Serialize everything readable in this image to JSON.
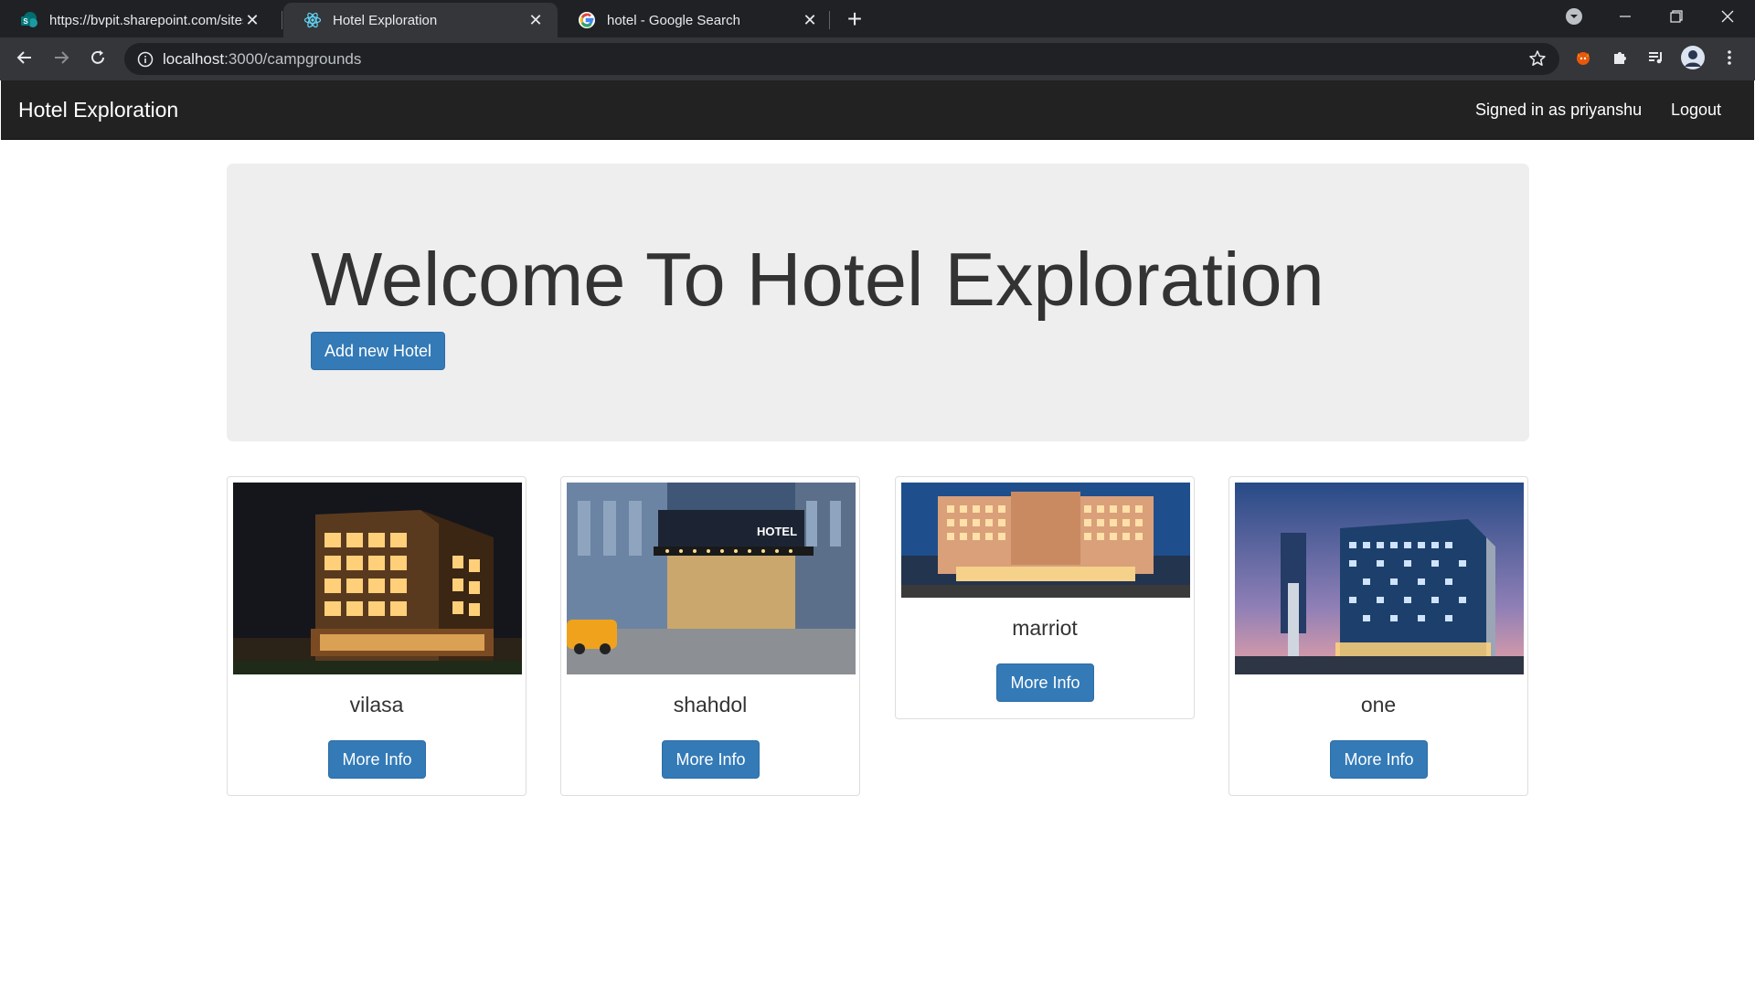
{
  "browser": {
    "tabs": [
      {
        "title": "https://bvpit.sharepoint.com/sites",
        "icon": "sharepoint-icon",
        "active": false
      },
      {
        "title": "Hotel Exploration",
        "icon": "react-icon",
        "active": true
      },
      {
        "title": "hotel - Google Search",
        "icon": "google-icon",
        "active": false
      }
    ],
    "url": {
      "host": "localhost",
      "path": ":3000/campgrounds"
    }
  },
  "navbar": {
    "brand": "Hotel Exploration",
    "signed_in": "Signed in as priyanshu",
    "logout": "Logout"
  },
  "jumbotron": {
    "heading": "Welcome To Hotel Exploration",
    "add_button": "Add new Hotel"
  },
  "hotels": [
    {
      "name": "vilasa",
      "button": "More Info"
    },
    {
      "name": "shahdol",
      "button": "More Info"
    },
    {
      "name": "marriot",
      "button": "More Info"
    },
    {
      "name": "one",
      "button": "More Info"
    }
  ],
  "colors": {
    "primary": "#337ab7",
    "navbar": "#222222",
    "jumbotron": "#eeeeee"
  }
}
